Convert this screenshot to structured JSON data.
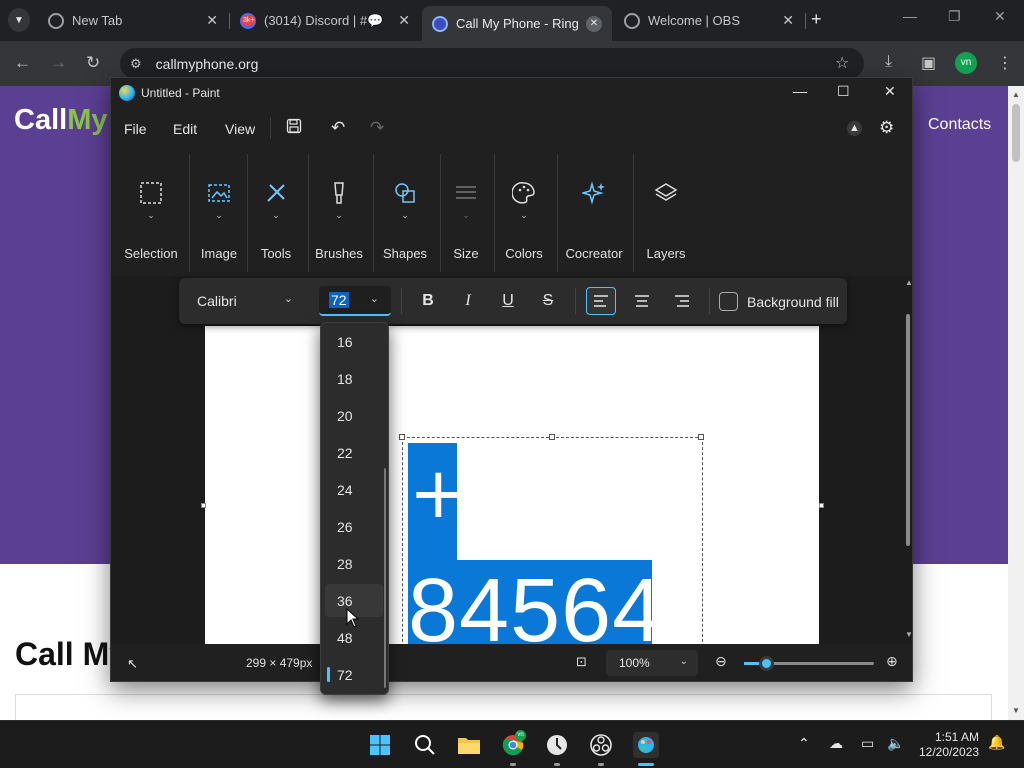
{
  "browser": {
    "tabs": [
      {
        "title": "New Tab",
        "favicon_color": "#9aa0a6"
      },
      {
        "title": "(3014) Discord | #💬 ",
        "favicon_color": "#ed4245",
        "badge": "3k+"
      },
      {
        "title": "Call My Phone - Ring y",
        "favicon_color": "#8ab4f8"
      },
      {
        "title": "Welcome | OBS",
        "favicon_color": "#9aa0a6"
      }
    ],
    "url": "callmyphone.org",
    "profile_initials": "vn"
  },
  "webpage": {
    "logo_left": "Call",
    "logo_right": "My",
    "nav_contacts": "Contacts",
    "heading": "Call My"
  },
  "paint": {
    "title": "Untitled - Paint",
    "menu": {
      "file": "File",
      "edit": "Edit",
      "view": "View"
    },
    "ribbon": [
      {
        "name": "selection",
        "label": "Selection"
      },
      {
        "name": "image",
        "label": "Image"
      },
      {
        "name": "tools",
        "label": "Tools"
      },
      {
        "name": "brushes",
        "label": "Brushes"
      },
      {
        "name": "shapes",
        "label": "Shapes"
      },
      {
        "name": "size",
        "label": "Size"
      },
      {
        "name": "colors",
        "label": "Colors"
      },
      {
        "name": "cocreator",
        "label": "Cocreator"
      },
      {
        "name": "layers",
        "label": "Layers"
      }
    ],
    "text_toolbar": {
      "font": "Calibri",
      "size": "72",
      "background_fill_label": "Background fill",
      "background_fill_checked": false
    },
    "canvas_text": {
      "symbol": "+",
      "number": "84564"
    },
    "font_sizes": [
      "16",
      "18",
      "20",
      "22",
      "24",
      "26",
      "28",
      "36",
      "48",
      "72"
    ],
    "hovered_size": "36",
    "selected_size": "72",
    "status": {
      "canvas_size": "299 × 479px",
      "zoom": "100%",
      "zoom_level": 0.16
    }
  },
  "taskbar": {
    "time": "1:51 AM",
    "date": "12/20/2023",
    "chrome_badge": "vn"
  },
  "colors": {
    "accent": "#4cc2ff",
    "selection_blue": "#0a78d7",
    "site_purple": "#5b3f93",
    "site_green": "#8bc34a"
  }
}
